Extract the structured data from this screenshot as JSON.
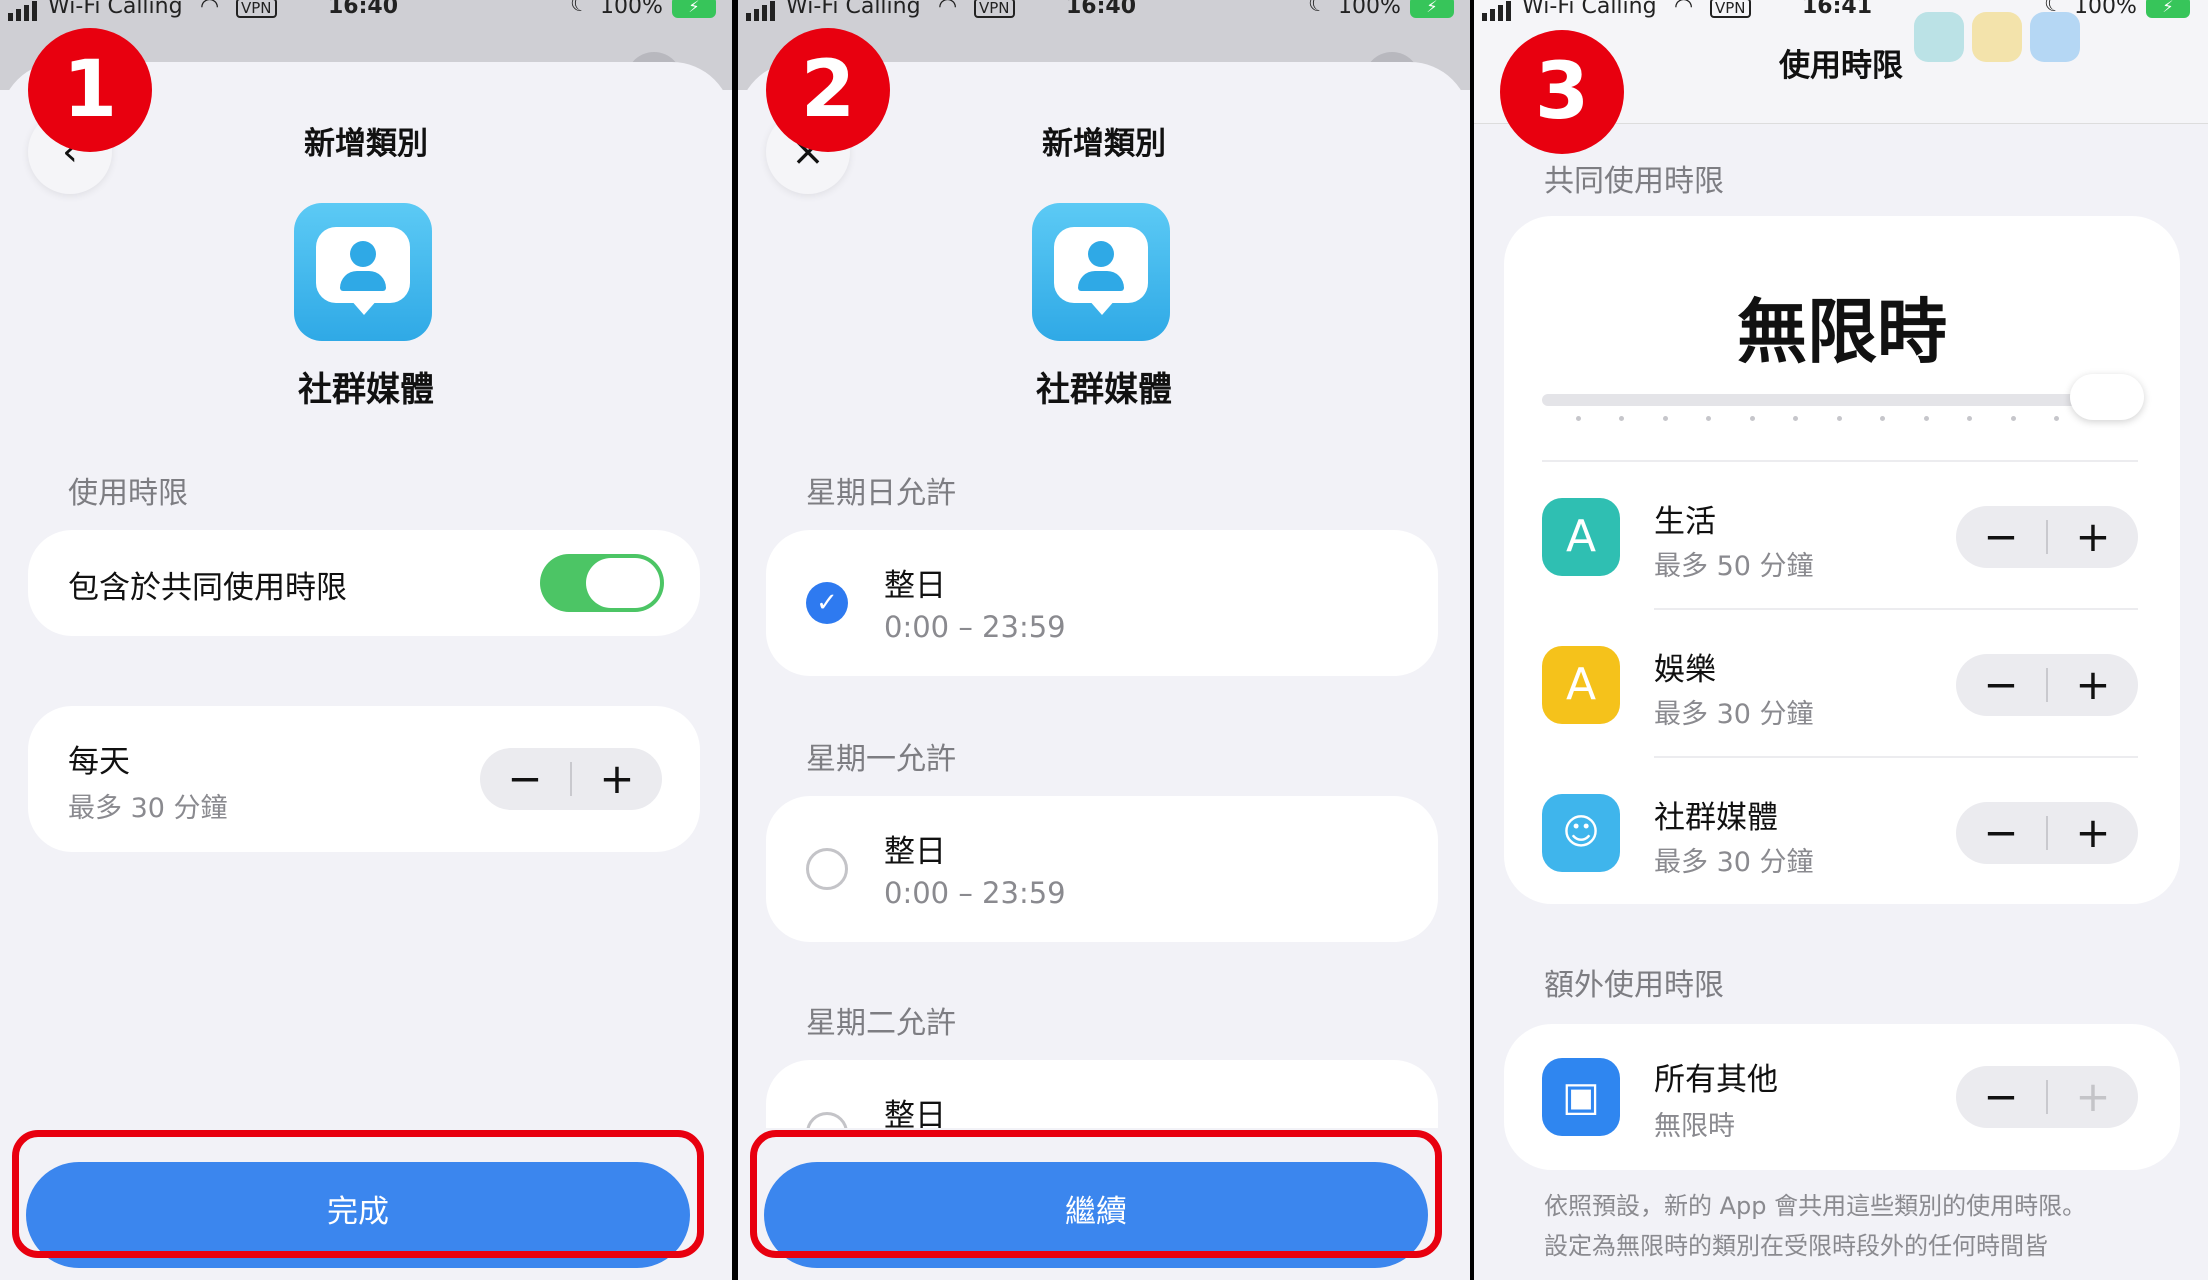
{
  "status": {
    "carrier": "Wi-Fi Calling",
    "vpn": "VPN",
    "time_1": "16:40",
    "time_2": "16:40",
    "time_3": "16:41",
    "battery": "100%"
  },
  "badges": [
    "1",
    "2",
    "3"
  ],
  "panel1": {
    "title": "新增類別",
    "back_glyph": "‹",
    "category_name": "社群媒體",
    "section_label": "使用時限",
    "include_shared_label": "包含於共同使用時限",
    "include_shared_on": true,
    "daily_label": "每天",
    "daily_limit": "最多 30 分鐘",
    "done_label": "完成"
  },
  "panel2": {
    "title": "新增類別",
    "close_glyph": "×",
    "category_name": "社群媒體",
    "days": [
      {
        "label": "星期日允許",
        "option": "整日",
        "range": "0:00 – 23:59",
        "selected": true
      },
      {
        "label": "星期一允許",
        "option": "整日",
        "range": "0:00 – 23:59",
        "selected": false
      },
      {
        "label": "星期二允許",
        "option": "整日",
        "range": "",
        "selected": false
      }
    ],
    "continue_label": "繼續"
  },
  "panel3": {
    "title": "使用時限",
    "shared_section": "共同使用時限",
    "shared_value": "無限時",
    "items": [
      {
        "name": "生活",
        "limit": "最多 50 分鐘",
        "icon": "app-store-icon",
        "color": "#2fbfb2"
      },
      {
        "name": "娛樂",
        "limit": "最多 30 分鐘",
        "icon": "app-store-icon",
        "color": "#f5c21b"
      },
      {
        "name": "社群媒體",
        "limit": "最多 30 分鐘",
        "icon": "chat-person-icon",
        "color": "#3fb5ec"
      }
    ],
    "extra_section": "額外使用時限",
    "extra_item": {
      "name": "所有其他",
      "limit": "無限時",
      "icon": "layers-icon",
      "color": "#2f86f0"
    },
    "footnote_1": "依照預設，新的 App 會共用這些類別的使用時限。",
    "footnote_2": "設定為無限時的類別在受限時段外的任何時間皆"
  },
  "colors": {
    "accent": "#3b86ee",
    "highlight": "#e8000f",
    "toggle_on": "#4cc565"
  },
  "glyphs": {
    "minus": "−",
    "plus": "+",
    "check": "✓"
  }
}
